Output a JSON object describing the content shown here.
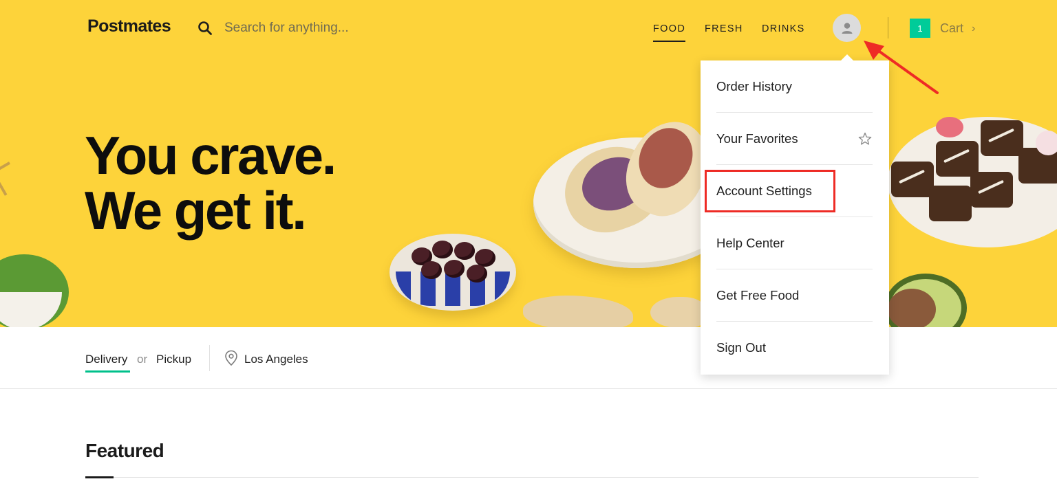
{
  "header": {
    "logo": "Postmates",
    "search_placeholder": "Search for anything...",
    "nav": [
      {
        "label": "FOOD",
        "active": true
      },
      {
        "label": "FRESH",
        "active": false
      },
      {
        "label": "DRINKS",
        "active": false
      }
    ],
    "cart": {
      "count": "1",
      "label": "Cart"
    }
  },
  "hero": {
    "headline_line1": "You crave.",
    "headline_line2": "We get it."
  },
  "account_menu": {
    "items": [
      {
        "label": "Order History"
      },
      {
        "label": "Your Favorites",
        "icon": "star-icon"
      },
      {
        "label": "Account Settings",
        "highlighted": true
      },
      {
        "label": "Help Center"
      },
      {
        "label": "Get Free Food"
      },
      {
        "label": "Sign Out"
      }
    ]
  },
  "delivery_bar": {
    "delivery": "Delivery",
    "or": "or",
    "pickup": "Pickup",
    "location": "Los Angeles"
  },
  "featured": {
    "title": "Featured"
  },
  "colors": {
    "hero_background": "#fdd33a",
    "accent_green": "#00c08b",
    "annotation_red": "#ee2b25"
  }
}
